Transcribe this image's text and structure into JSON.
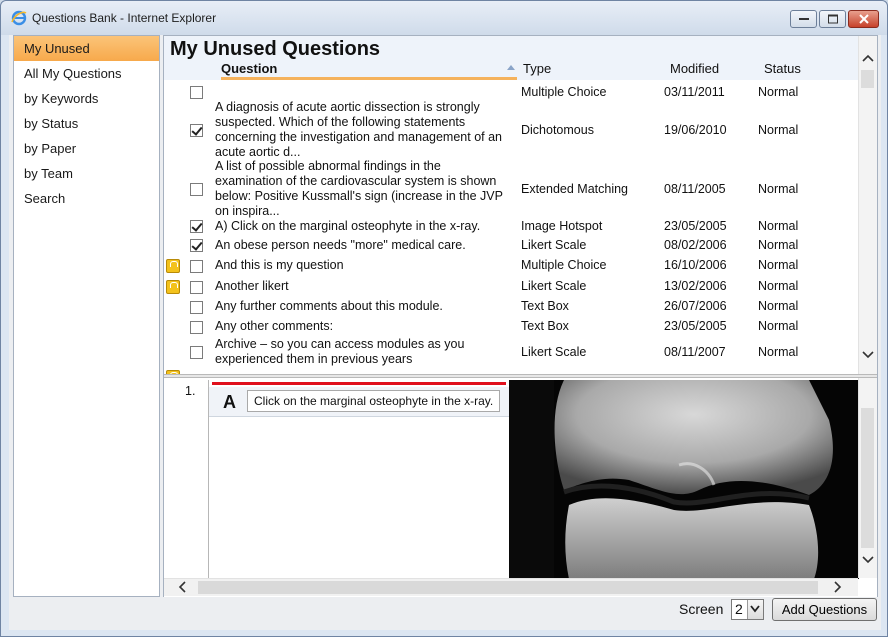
{
  "window": {
    "title": "Questions Bank - Internet Explorer"
  },
  "sidebar": {
    "items": [
      {
        "label": "My Unused"
      },
      {
        "label": "All My Questions"
      },
      {
        "label": "by Keywords"
      },
      {
        "label": "by Status"
      },
      {
        "label": "by Paper"
      },
      {
        "label": "by Team"
      },
      {
        "label": "Search"
      }
    ]
  },
  "main": {
    "title": "My Unused Questions",
    "columns": {
      "question": "Question",
      "type": "Type",
      "modified": "Modified",
      "status": "Status"
    },
    "rows": [
      {
        "question": "",
        "type": "Multiple Choice",
        "modified": "03/11/2011",
        "status": "Normal",
        "checked": false,
        "locked": false
      },
      {
        "question": "A diagnosis of acute aortic dissection is strongly suspected. Which of the following statements concerning the investigation and management of an acute aortic d...",
        "type": "Dichotomous",
        "modified": "19/06/2010",
        "status": "Normal",
        "checked": true,
        "locked": false
      },
      {
        "question": "A list of possible abnormal findings in the examination of the cardiovascular system is shown below: Positive Kussmall's sign (increase in the JVP on inspira...",
        "type": "Extended Matching",
        "modified": "08/11/2005",
        "status": "Normal",
        "checked": false,
        "locked": false
      },
      {
        "question": "A) Click on the marginal osteophyte in the x-ray.",
        "type": "Image Hotspot",
        "modified": "23/05/2005",
        "status": "Normal",
        "checked": true,
        "locked": false
      },
      {
        "question": "An obese person needs \"more\" medical care.",
        "type": "Likert Scale",
        "modified": "08/02/2006",
        "status": "Normal",
        "checked": true,
        "locked": false
      },
      {
        "question": "And this is my question",
        "type": "Multiple Choice",
        "modified": "16/10/2006",
        "status": "Normal",
        "checked": false,
        "locked": true
      },
      {
        "question": "Another likert",
        "type": "Likert Scale",
        "modified": "13/02/2006",
        "status": "Normal",
        "checked": false,
        "locked": true
      },
      {
        "question": "Any further comments about this module.",
        "type": "Text Box",
        "modified": "26/07/2006",
        "status": "Normal",
        "checked": false,
        "locked": false
      },
      {
        "question": "Any other comments:",
        "type": "Text Box",
        "modified": "23/05/2005",
        "status": "Normal",
        "checked": false,
        "locked": false
      },
      {
        "question": "Archive – so you can access modules as you experienced them in previous years",
        "type": "Likert Scale",
        "modified": "08/11/2007",
        "status": "Normal",
        "checked": false,
        "locked": false
      }
    ]
  },
  "preview": {
    "number": "1.",
    "letter": "A",
    "label": "Click on the marginal osteophyte in the x-ray."
  },
  "footer": {
    "screen_label": "Screen",
    "screen_value": "2",
    "add_button": "Add Questions"
  },
  "colors": {
    "active_nav": "#f7a94b",
    "hotspot_line": "#e0101c",
    "lock": "#f3c21c"
  }
}
